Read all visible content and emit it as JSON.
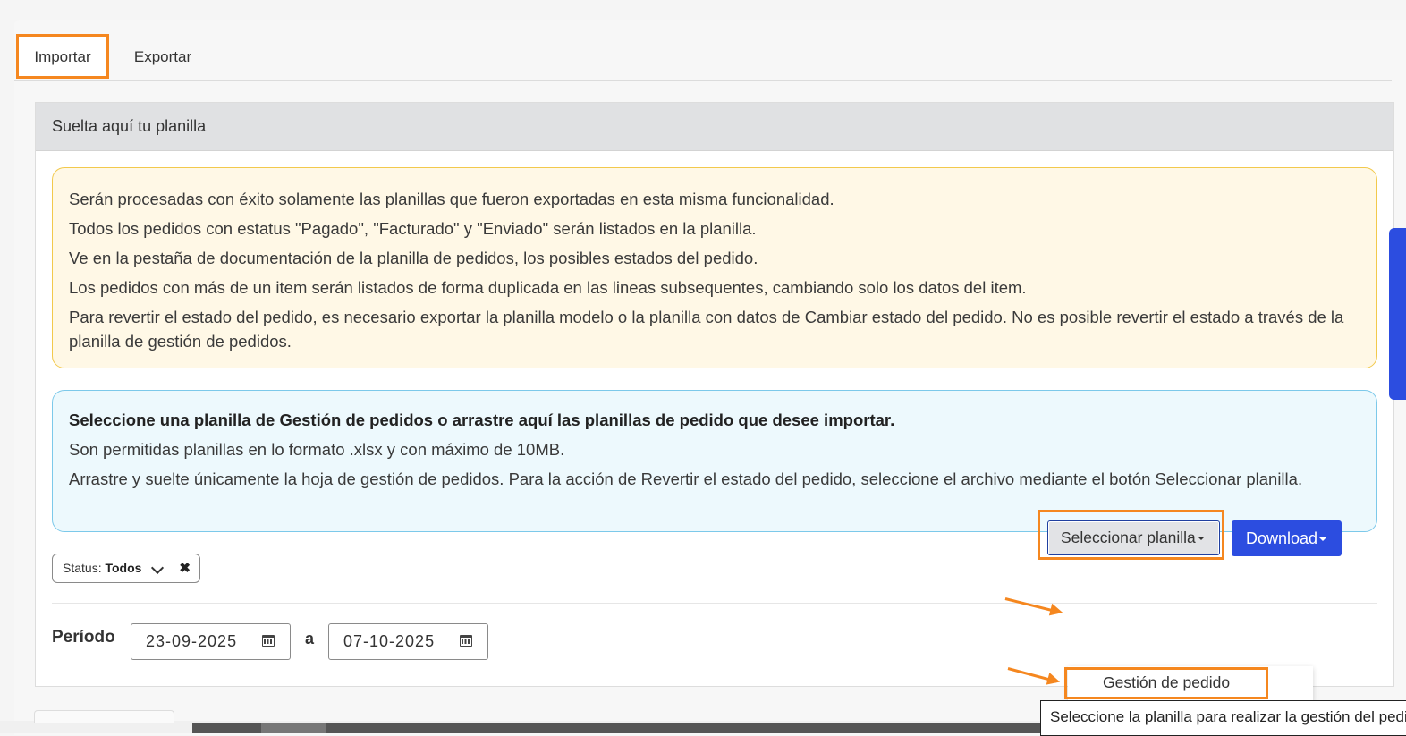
{
  "tabs": [
    {
      "label": "Importar",
      "active": true
    },
    {
      "label": "Exportar",
      "active": false
    }
  ],
  "panel": {
    "header": "Suelta aquí tu planilla"
  },
  "warning_notes": [
    "Serán procesadas con éxito solamente las planillas que fueron exportadas en esta misma funcionalidad.",
    "Todos los pedidos con estatus \"Pagado\", \"Facturado\" y \"Enviado\" serán listados en la planilla.",
    "Ve en la pestaña de documentación de la planilla de pedidos, los posibles estados del pedido.",
    "Los pedidos con más de un item serán listados de forma duplicada en las lineas subsequentes, cambiando solo los datos del item.",
    "Para revertir el estado del pedido, es necesario exportar la planilla modelo o la planilla con datos de Cambiar estado del pedido. No es posible revertir el estado a través de la planilla de gestión de pedidos."
  ],
  "info": {
    "title": "Seleccione una planilla de Gestión de pedidos o arrastre aquí las planillas de pedido que desee importar.",
    "line1": "Son permitidas planillas en lo formato .xlsx y con máximo de 10MB.",
    "line2": "Arrastre y suelte únicamente la hoja de gestión de pedidos. Para la acción de Revertir el estado del pedido, seleccione el archivo mediante el botón Seleccionar planilla."
  },
  "filter": {
    "label": "Status:",
    "value": "Todos",
    "remove_icon": "close-icon"
  },
  "period": {
    "label": "Período",
    "from": "23-09-2025",
    "separator": "a",
    "to": "07-10-2025",
    "icon": "calendar-icon"
  },
  "actions": {
    "select_label": "Seleccionar planilla",
    "download_label": "Download"
  },
  "dropdown": {
    "items": [
      "Gestión de pedido"
    ]
  },
  "tooltip": "Seleccione la planilla para realizar la gestión del pedido",
  "colors": {
    "accent_blue": "#2c4de0",
    "highlight_orange": "#f5871f",
    "warning_bg": "#fff8e6",
    "info_bg": "#edf9fd"
  }
}
